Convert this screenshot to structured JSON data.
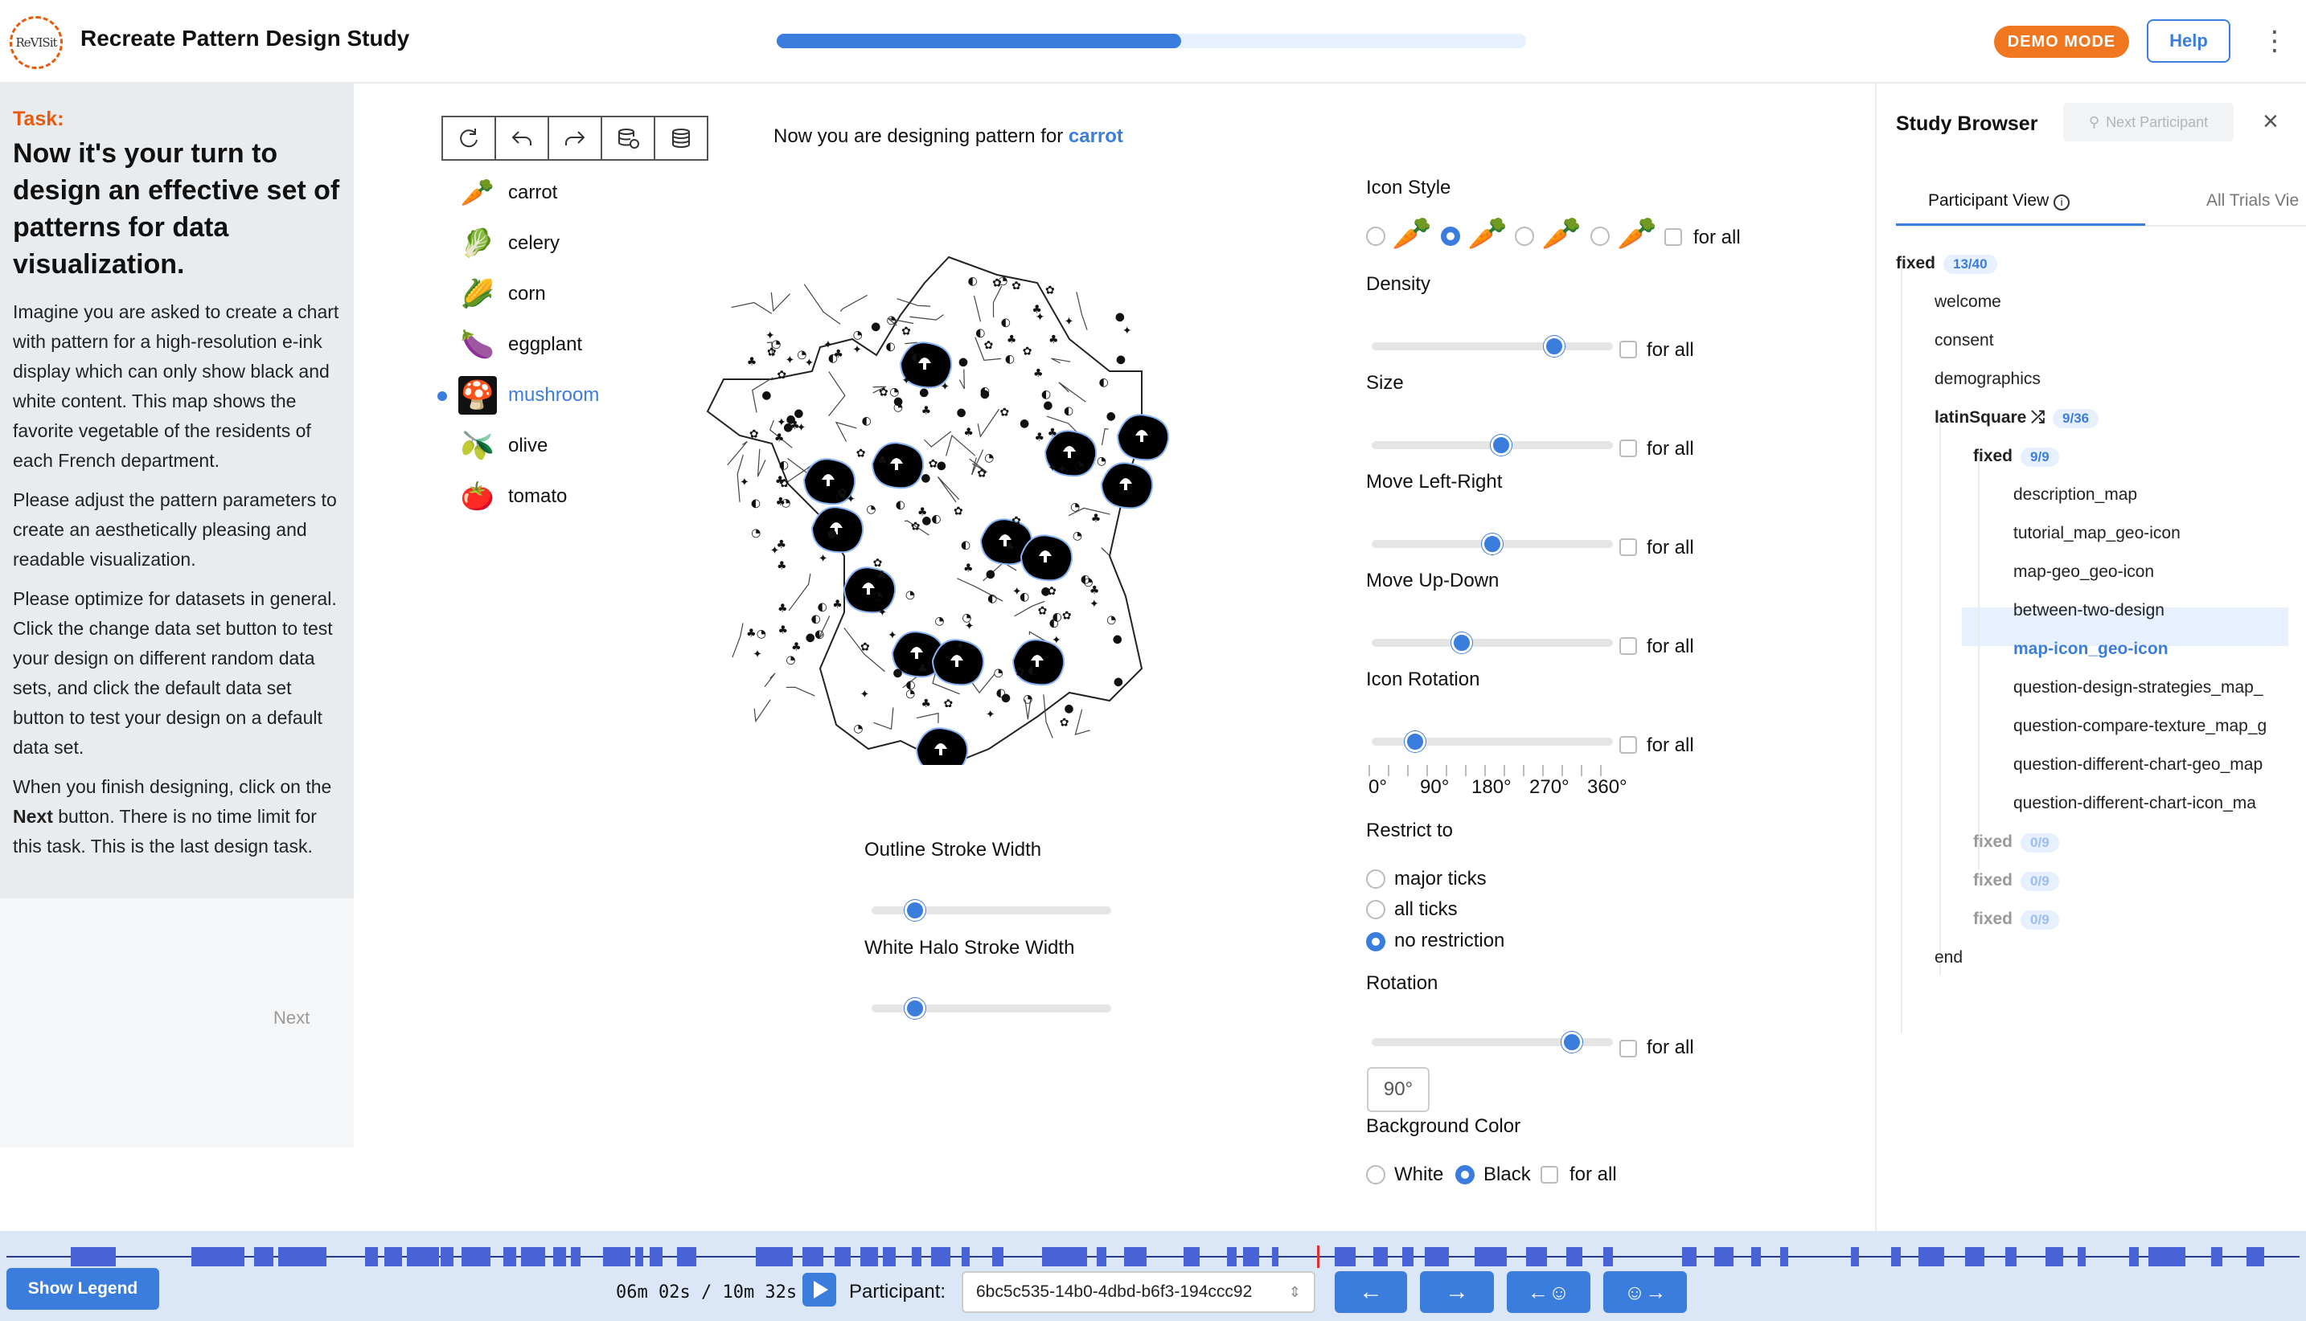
{
  "header": {
    "logo_text": "ReVISit",
    "title": "Recreate Pattern Design Study",
    "progress": 0.54,
    "demo_label": "DEMO MODE",
    "help_label": "Help",
    "menu_icon": "kebab-icon"
  },
  "task": {
    "label": "Task:",
    "title": "Now it's your turn to design an effective set of patterns for data visualization.",
    "p1": "Imagine you are asked to create a chart with pattern for a high-resolution e-ink display which can only show black and white content. This map shows the favorite vegetable of the residents of each French department.",
    "p2": "Please adjust the pattern parameters to create an aesthetically pleasing and readable visualization.",
    "p3": "Please optimize for datasets in general. Click the change data set button to test your design on different random data sets, and click the default data set button to test your design on a default data set.",
    "p4_a": "When you finish designing, click on the ",
    "p4_b": "Next",
    "p4_c": " button. There is no time limit for this task. This is the last design task.",
    "next_label": "Next"
  },
  "toolbar": {
    "icons": [
      "reset-icon",
      "undo-icon",
      "redo-icon",
      "change-dataset-icon",
      "default-dataset-icon"
    ]
  },
  "vegetables": {
    "items": [
      {
        "label": "carrot",
        "icon": "🥕"
      },
      {
        "label": "celery",
        "icon": "🥬"
      },
      {
        "label": "corn",
        "icon": "🌽"
      },
      {
        "label": "eggplant",
        "icon": "🍆"
      },
      {
        "label": "mushroom",
        "icon": "🍄"
      },
      {
        "label": "olive",
        "icon": "🫒"
      },
      {
        "label": "tomato",
        "icon": "🍅"
      }
    ],
    "selected": "mushroom"
  },
  "design": {
    "prefix": "Now you are designing pattern for ",
    "target": "carrot"
  },
  "controls": {
    "icon_style_label": "Icon Style",
    "icon_style_selected": 1,
    "density_label": "Density",
    "density_value": 0.78,
    "size_label": "Size",
    "size_value": 0.54,
    "move_lr_label": "Move Left-Right",
    "move_lr_value": 0.5,
    "move_ud_label": "Move Up-Down",
    "move_ud_value": 0.36,
    "icon_rotation_label": "Icon Rotation",
    "icon_rotation_value": 0.15,
    "for_all": "for all",
    "deg_0": "0°",
    "deg_90": "90°",
    "deg_180": "180°",
    "deg_270": "270°",
    "deg_360": "360°",
    "restrict_label": "Restrict to",
    "restrict_major": "major ticks",
    "restrict_all": "all ticks",
    "restrict_none": "no restriction",
    "rotation_label": "Rotation",
    "rotation_value": 0.86,
    "rotation_input": "90°",
    "bg_label": "Background Color",
    "bg_white": "White",
    "bg_black": "Black",
    "outline_label": "Outline Stroke Width",
    "outline_value": 0.15,
    "halo_label": "White Halo Stroke Width",
    "halo_value": 0.15
  },
  "sidebar": {
    "title": "Study Browser",
    "next_participant": "Next Participant",
    "tab_participant": "Participant View",
    "tab_trials": "All Trials Vie",
    "tree": {
      "fixed": "fixed",
      "fixed_badge": "13/40",
      "welcome": "welcome",
      "consent": "consent",
      "demographics": "demographics",
      "latin": "latinSquare",
      "latin_badge": "9/36",
      "fixed_inner": "fixed",
      "fixed_inner_badge": "9/9",
      "t1": "description_map",
      "t2": "tutorial_map_geo-icon",
      "t3": "map-geo_geo-icon",
      "t4": "between-two-design",
      "t5": "map-icon_geo-icon",
      "t6": "question-design-strategies_map_",
      "t7": "question-compare-texture_map_g",
      "t8": "question-different-chart-geo_map",
      "t9": "question-different-chart-icon_ma",
      "f2": "fixed",
      "f2_badge": "0/9",
      "f3": "fixed",
      "f3_badge": "0/9",
      "f4": "fixed",
      "f4_badge": "0/9",
      "end": "end"
    }
  },
  "bottom": {
    "show_legend": "Show Legend",
    "time": "06m 02s / 10m 32s",
    "participant_label": "Participant:",
    "participant_id": "6bc5c535-14b0-4dbd-b6f3-194ccc92",
    "colors": {
      "accent": "#3b7ddd",
      "timeline": "#4763d6",
      "cursor": "#e03131"
    }
  }
}
